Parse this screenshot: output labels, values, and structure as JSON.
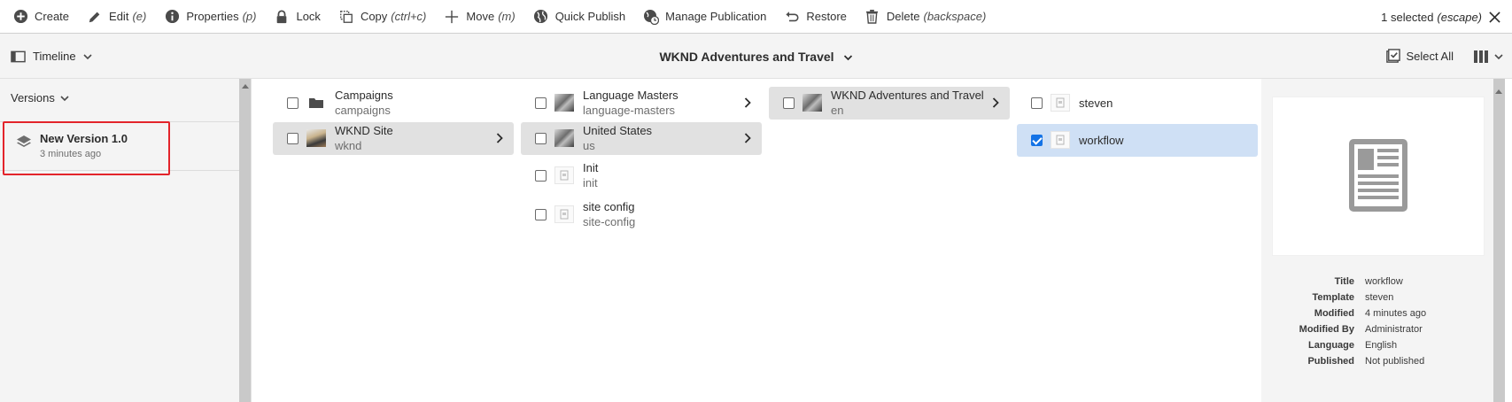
{
  "actionbar": {
    "create": "Create",
    "edit": "Edit",
    "edit_sc": "(e)",
    "properties": "Properties",
    "properties_sc": "(p)",
    "lock": "Lock",
    "copy": "Copy",
    "copy_sc": "(ctrl+c)",
    "move": "Move",
    "move_sc": "(m)",
    "quick_publish": "Quick Publish",
    "manage_publication": "Manage Publication",
    "restore": "Restore",
    "delete": "Delete",
    "delete_sc": "(backspace)",
    "selected": "1 selected",
    "selected_sc": "(escape)"
  },
  "titlebar": {
    "rail_toggle": "Timeline",
    "title": "WKND Adventures and Travel",
    "select_all": "Select All"
  },
  "rail": {
    "header": "Versions",
    "version_title": "New Version 1.0",
    "version_time": "3 minutes ago"
  },
  "columns": {
    "col1": [
      {
        "title": "Campaigns",
        "name": "campaigns"
      },
      {
        "title": "WKND Site",
        "name": "wknd"
      }
    ],
    "col2": [
      {
        "title": "Language Masters",
        "name": "language-masters"
      },
      {
        "title": "United States",
        "name": "us"
      },
      {
        "title": "Init",
        "name": "init"
      },
      {
        "title": "site config",
        "name": "site-config"
      }
    ],
    "col3": [
      {
        "title": "WKND Adventures and Travel",
        "name": "en"
      }
    ],
    "col4": [
      {
        "title": "steven"
      },
      {
        "title": "workflow"
      }
    ]
  },
  "meta": {
    "rows": [
      {
        "k": "Title",
        "v": "workflow"
      },
      {
        "k": "Template",
        "v": "steven"
      },
      {
        "k": "Modified",
        "v": "4 minutes ago"
      },
      {
        "k": "Modified By",
        "v": "Administrator"
      },
      {
        "k": "Language",
        "v": "English"
      },
      {
        "k": "Published",
        "v": "Not published"
      }
    ]
  },
  "colors": {
    "accent": "#1473e6",
    "highlight_border": "#e3242b",
    "selected_bg": "#cfe0f5"
  }
}
